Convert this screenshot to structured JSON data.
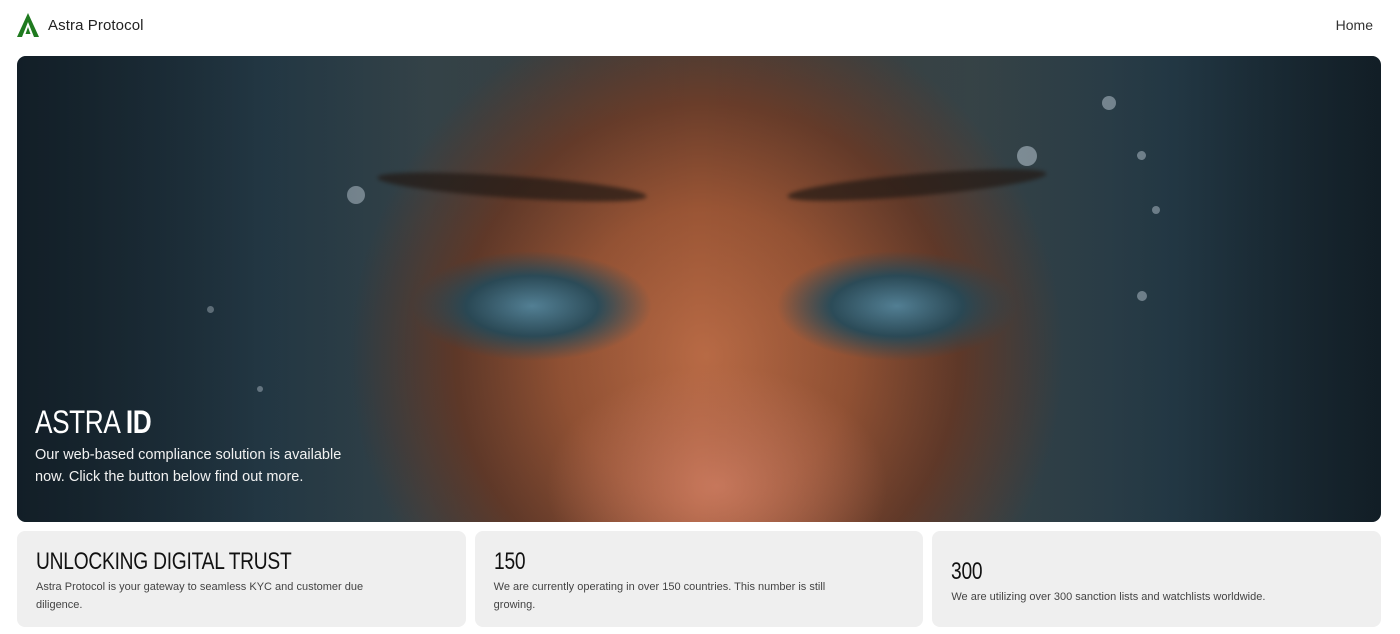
{
  "header": {
    "brand_name": "Astra Protocol",
    "logo_icon": "astra-a-logo",
    "brand_color": "#1f7a1f",
    "nav": {
      "home_label": "Home"
    }
  },
  "hero": {
    "title_light": "ASTRA ",
    "title_bold": "ID",
    "description": "Our web-based compliance solution is available now. Click the button below find out more."
  },
  "cards": [
    {
      "title": "UNLOCKING DIGITAL TRUST",
      "text": "Astra Protocol is your gateway to seamless KYC and customer due diligence."
    },
    {
      "title": "150",
      "text": "We are currently operating in over 150 countries. This number is still growing."
    },
    {
      "title": "300",
      "text": "We are utilizing over 300 sanction lists and watchlists worldwide."
    }
  ]
}
